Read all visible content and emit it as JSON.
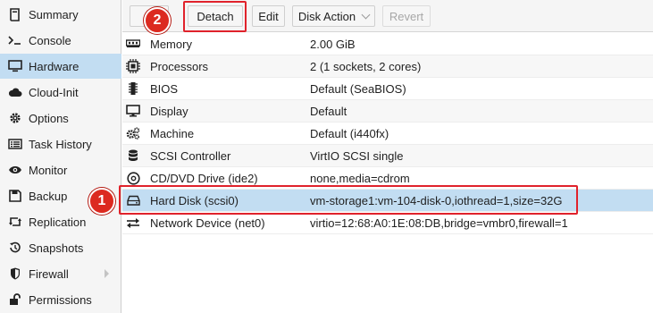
{
  "sidebar": {
    "items": [
      {
        "label": "Summary",
        "icon": "book-icon"
      },
      {
        "label": "Console",
        "icon": "terminal-icon"
      },
      {
        "label": "Hardware",
        "icon": "monitor-icon",
        "active": true
      },
      {
        "label": "Cloud-Init",
        "icon": "cloud-icon"
      },
      {
        "label": "Options",
        "icon": "gear-icon"
      },
      {
        "label": "Task History",
        "icon": "list-icon"
      },
      {
        "label": "Monitor",
        "icon": "eye-icon"
      },
      {
        "label": "Backup",
        "icon": "floppy-icon"
      },
      {
        "label": "Replication",
        "icon": "retweet-icon"
      },
      {
        "label": "Snapshots",
        "icon": "history-icon"
      },
      {
        "label": "Firewall",
        "icon": "shield-icon"
      },
      {
        "label": "Permissions",
        "icon": "unlock-icon"
      }
    ]
  },
  "toolbar": {
    "detach_label": "Detach",
    "edit_label": "Edit",
    "disk_action_label": "Disk Action",
    "revert_label": "Revert"
  },
  "hardware": [
    {
      "name": "Memory",
      "value": "2.00 GiB",
      "icon": "memory-icon"
    },
    {
      "name": "Processors",
      "value": "2 (1 sockets, 2 cores)",
      "icon": "cpu-icon"
    },
    {
      "name": "BIOS",
      "value": "Default (SeaBIOS)",
      "icon": "microchip-icon"
    },
    {
      "name": "Display",
      "value": "Default",
      "icon": "desktop-icon"
    },
    {
      "name": "Machine",
      "value": "Default (i440fx)",
      "icon": "cogs-icon"
    },
    {
      "name": "SCSI Controller",
      "value": "VirtIO SCSI single",
      "icon": "database-icon"
    },
    {
      "name": "CD/DVD Drive (ide2)",
      "value": "none,media=cdrom",
      "icon": "cdrom-icon"
    },
    {
      "name": "Hard Disk (scsi0)",
      "value": "vm-storage1:vm-104-disk-0,iothread=1,size=32G",
      "icon": "hdd-icon",
      "selected": true
    },
    {
      "name": "Network Device (net0)",
      "value": "virtio=12:68:A0:1E:08:DB,bridge=vmbr0,firewall=1",
      "icon": "exchange-icon"
    }
  ],
  "annotations": {
    "badge_1": "1",
    "badge_2": "2",
    "color": "#e0222b"
  },
  "colors": {
    "selected_bg": "#c2ddf2"
  }
}
